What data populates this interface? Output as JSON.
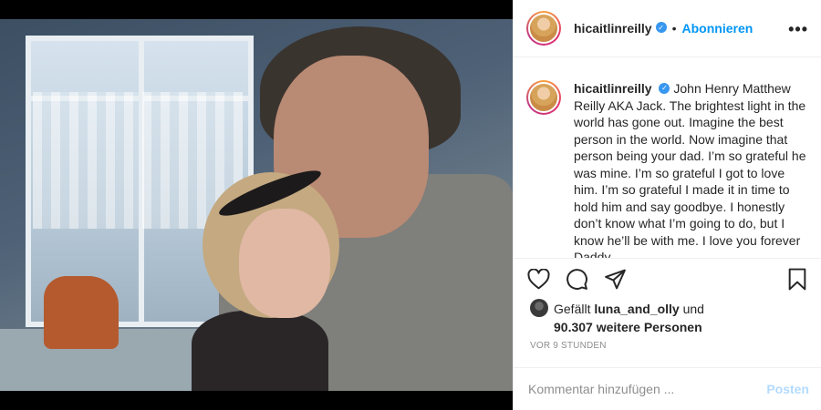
{
  "post": {
    "username": "hicaitlinreilly",
    "follow_label": "Abonnieren",
    "separator": "•",
    "more_label": "•••",
    "caption_text": "John Henry Matthew Reilly AKA Jack. The brightest light in the world has gone out. Imagine the best person in the world. Now imagine that person being your dad. I’m so grateful he was mine. I’m so grateful I got to love him. I’m so grateful I made it in time to hold him and say goodbye. I honestly don’t know what I’m going to do, but I know he’ll be with me. I love you forever Daddy.",
    "likes": {
      "prefix": "Gefällt",
      "first_liker": "luna_and_olly",
      "joiner": "und",
      "count_text": "90.307 weitere Personen"
    },
    "timestamp": "VOR 9 STUNDEN",
    "comment": {
      "placeholder": "Kommentar hinzufügen ...",
      "post_label": "Posten"
    }
  },
  "icons": {
    "like": "heart-icon",
    "comment": "comment-icon",
    "share": "share-icon",
    "save": "bookmark-icon",
    "verified": "verified-badge-icon"
  },
  "colors": {
    "link_blue": "#0095f6",
    "post_disabled": "#b3dbff",
    "verified": "#3897f0",
    "muted": "#8e8e8e"
  }
}
